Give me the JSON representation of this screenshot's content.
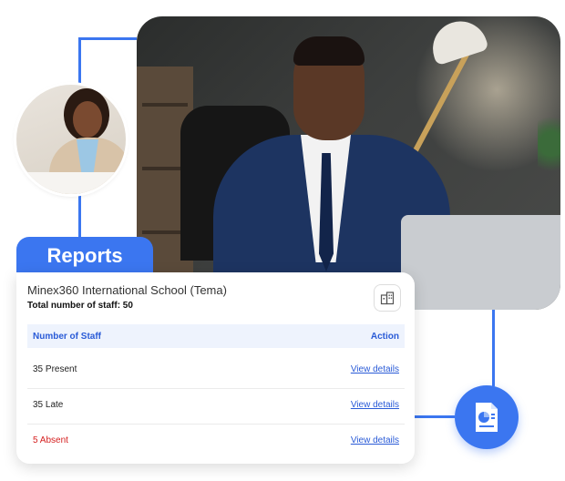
{
  "reports_tab": {
    "label": "Reports"
  },
  "card": {
    "school_name": "Minex360 International School (Tema)",
    "total_staff": "Total number of staff: 50",
    "table": {
      "col_staff": "Number of Staff",
      "col_action": "Action",
      "rows": [
        {
          "status": "35 Present",
          "action": "View details"
        },
        {
          "status": "35 Late",
          "action": "View details"
        },
        {
          "status": "5 Absent",
          "action": "View details"
        }
      ]
    }
  },
  "icons": {
    "building": "building-icon",
    "report": "report-document-icon"
  },
  "colors": {
    "accent": "#3b76f0",
    "link": "#2a5bd7",
    "absent": "#d51f1f"
  }
}
